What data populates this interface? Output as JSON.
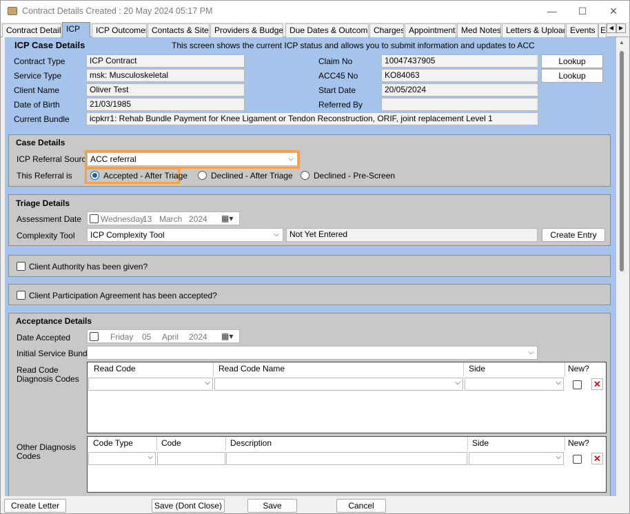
{
  "window": {
    "title": "Contract Details Created : 20 May 2024 05:17 PM",
    "minimize": "—",
    "maximize": "☐",
    "close": "✕"
  },
  "tabs": [
    "Contract Details",
    "ICP",
    "ICP Outcomes",
    "Contacts & Sites",
    "Providers & Budgets",
    "Due Dates & Outcomes",
    "Charges",
    "Appointments",
    "Med Notes",
    "Letters & Uploads",
    "Events",
    "E"
  ],
  "tab_scroll": {
    "left": "◀",
    "right": "▶"
  },
  "case_header": {
    "title": "ICP Case Details",
    "info": "This screen shows the current ICP status and allows you to submit information and updates to ACC"
  },
  "summary": {
    "contract_type": {
      "label": "Contract Type",
      "value": "ICP Contract"
    },
    "service_type": {
      "label": "Service Type",
      "value": "msk: Musculoskeletal"
    },
    "client_name": {
      "label": "Client Name",
      "value": "Oliver Test"
    },
    "dob": {
      "label": "Date of Birth",
      "value": "21/03/1985"
    },
    "bundle": {
      "label": "Current Bundle",
      "value": "icpkrr1: Rehab Bundle Payment for Knee Ligament or Tendon Reconstruction, ORIF, joint replacement Level 1"
    },
    "claim_no": {
      "label": "Claim No",
      "value": "10047437905"
    },
    "acc45": {
      "label": "ACC45 No",
      "value": "KO84063"
    },
    "start_date": {
      "label": "Start Date",
      "value": "20/05/2024"
    },
    "referred_by": {
      "label": "Referred By",
      "value": ""
    },
    "lookup1": "Lookup",
    "lookup2": "Lookup"
  },
  "case_details": {
    "title": "Case Details",
    "source_label": "ICP Referral Source",
    "source_value": "ACC referral",
    "referral_label": "This Referral is",
    "options": [
      "Accepted - After Triage",
      "Declined - After Triage",
      "Declined - Pre-Screen"
    ],
    "selected": "Accepted - After Triage"
  },
  "triage": {
    "title": "Triage Details",
    "assessment_label": "Assessment Date",
    "assessment_date": {
      "weekday": "Wednesday",
      "day": "13",
      "month": "March",
      "year": "2024"
    },
    "complexity_label": "Complexity Tool",
    "complexity_value": "ICP Complexity Tool",
    "complexity_status": "Not Yet Entered",
    "create_entry": "Create Entry"
  },
  "authority": {
    "label": "Client Authority has been given?",
    "checked": false
  },
  "participation": {
    "label": "Client Participation Agreement has been accepted?",
    "checked": false
  },
  "acceptance": {
    "title": "Acceptance Details",
    "date_label": "Date Accepted",
    "date": {
      "weekday": "Friday",
      "day": "05",
      "month": "April",
      "year": "2024"
    },
    "bundle_label": "Initial Service Bundle",
    "read_code_label_1": "Read Code",
    "read_code_label_2": "Diagnosis Codes",
    "read_grid_headers": [
      "Read Code",
      "Read Code Name",
      "Side",
      "New?"
    ],
    "other_label_1": "Other Diagnosis",
    "other_label_2": "Codes",
    "other_grid_headers": [
      "Code Type",
      "Code",
      "Description",
      "Side",
      "New?"
    ]
  },
  "bottom_buttons": {
    "create_letter": "Create Letter",
    "save_dont_close": "Save (Dont Close)",
    "save": "Save",
    "cancel": "Cancel"
  },
  "colors": {
    "content_bg": "#a6c3eb",
    "section_bg": "#c8c8c8",
    "highlight": "#f4a14a",
    "radio_on": "#1a5fb4",
    "delete_x": "#d01010"
  }
}
